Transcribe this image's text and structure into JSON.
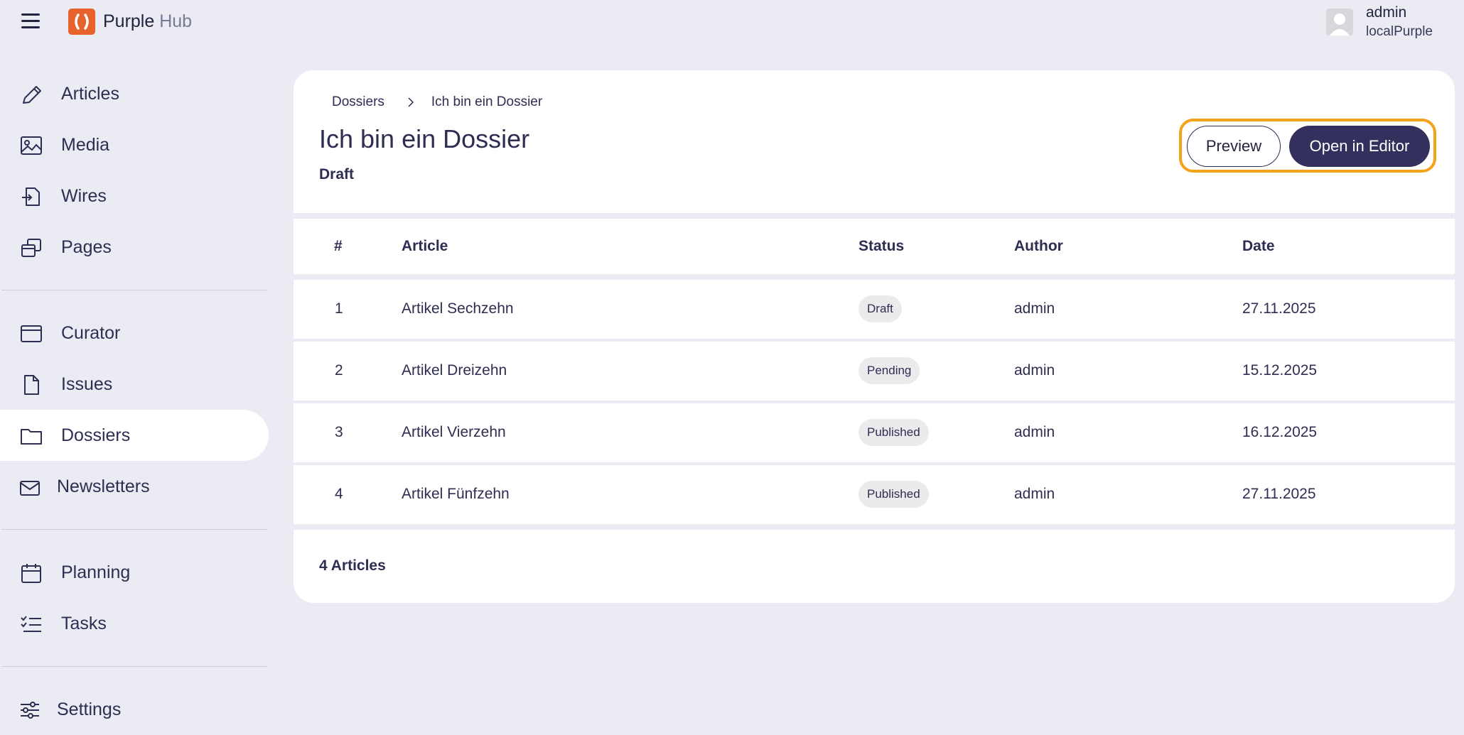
{
  "app": {
    "brand_main": "Purple",
    "brand_sub": "Hub"
  },
  "user": {
    "name": "admin",
    "org": "localPurple"
  },
  "sidebar": {
    "items": [
      {
        "label": "Articles"
      },
      {
        "label": "Media"
      },
      {
        "label": "Wires"
      },
      {
        "label": "Pages"
      },
      {
        "label": "Curator"
      },
      {
        "label": "Issues"
      },
      {
        "label": "Dossiers"
      },
      {
        "label": "Newsletters"
      },
      {
        "label": "Planning"
      },
      {
        "label": "Tasks"
      },
      {
        "label": "Settings"
      }
    ],
    "active": "Dossiers"
  },
  "breadcrumb": {
    "parent": "Dossiers",
    "current": "Ich bin ein Dossier"
  },
  "page": {
    "title": "Ich bin ein Dossier",
    "status": "Draft"
  },
  "actions": {
    "preview": "Preview",
    "open_editor": "Open in Editor"
  },
  "table": {
    "headers": [
      "#",
      "Article",
      "Status",
      "Author",
      "Date"
    ],
    "rows": [
      {
        "num": "1",
        "article": "Artikel Sechzehn",
        "status": "Draft",
        "author": "admin",
        "date": "27.11.2025"
      },
      {
        "num": "2",
        "article": "Artikel Dreizehn",
        "status": "Pending",
        "author": "admin",
        "date": "15.12.2025"
      },
      {
        "num": "3",
        "article": "Artikel Vierzehn",
        "status": "Published",
        "author": "admin",
        "date": "16.12.2025"
      },
      {
        "num": "4",
        "article": "Artikel Fünfzehn",
        "status": "Published",
        "author": "admin",
        "date": "27.11.2025"
      }
    ]
  },
  "footer": {
    "count": "4 Articles"
  },
  "colors": {
    "accent": "#33305e",
    "highlight": "#f5a11a",
    "logo": "#e8632b",
    "background": "#ebebf3"
  }
}
